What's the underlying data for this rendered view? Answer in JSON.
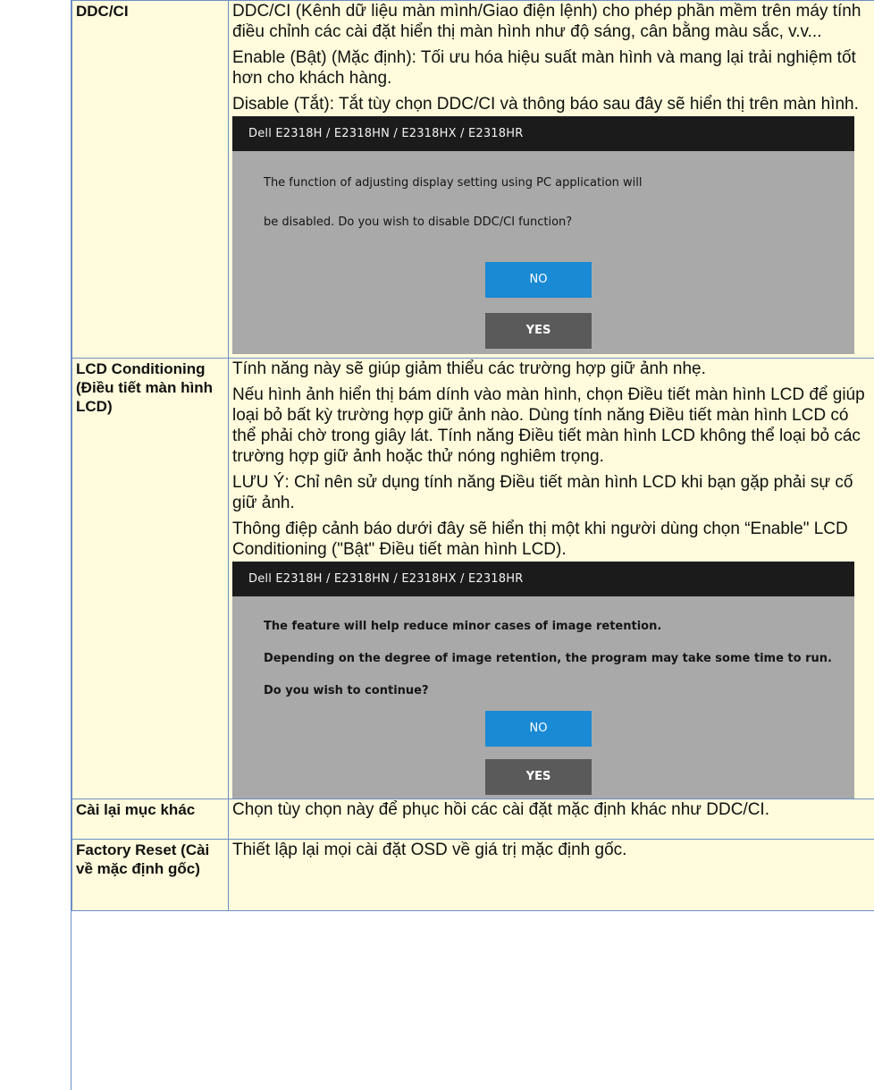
{
  "rows": [
    {
      "label": "DDC/CI",
      "paragraphs": [
        "DDC/CI (Kênh dữ liệu màn mình/Giao điện lệnh) cho phép phần mềm trên máy tính điều chỉnh các cài đặt hiển thị màn hình như độ sáng, cân bằng màu sắc, v.v...",
        "Enable (Bật) (Mặc định): Tối ưu hóa hiệu suất màn hình và mang lại trải nghiệm tốt hơn cho khách hàng.",
        "Disable (Tắt): Tắt tùy chọn DDC/CI và thông báo sau đây sẽ hiển thị trên màn hình."
      ],
      "dialog": {
        "title": "Dell  E2318H / E2318HN / E2318HX / E2318HR",
        "lines": [
          "The function of adjusting display setting using PC application will",
          "be disabled. Do you wish to disable DDC/CI function?"
        ],
        "no_label": "NO",
        "yes_label": "YES"
      }
    },
    {
      "label": "LCD Conditioning (Điều tiết màn hình LCD)",
      "paragraphs": [
        "Tính năng này sẽ giúp giảm thiểu các trường hợp giữ ảnh nhẹ.",
        "Nếu hình ảnh hiển thị bám dính vào màn hình, chọn Điều tiết màn hình LCD để giúp loại bỏ bất kỳ trường hợp giữ ảnh nào. Dùng tính năng Điều tiết màn hình LCD có thể phải chờ trong giây lát. Tính năng Điều tiết màn hình LCD không thể loại bỏ các trường hợp giữ ảnh hoặc thử nóng nghiêm trọng.",
        "LƯU Ý: Chỉ nên sử dụng tính năng Điều tiết màn hình LCD khi bạn gặp phải sự cố giữ ảnh.",
        "Thông điệp cảnh báo dưới đây sẽ hiển thị một khi người dùng chọn “Enable\" LCD Conditioning (\"Bật\" Điều tiết màn hình LCD)."
      ],
      "dialog": {
        "title": "Dell  E2318H / E2318HN / E2318HX / E2318HR",
        "lines": [
          "The feature will help reduce minor cases of image retention.",
          "Depending on the degree of image retention, the program may take some time to run.",
          "Do you wish to continue?"
        ],
        "no_label": "NO",
        "yes_label": "YES"
      }
    },
    {
      "label": "Cài lại mục khác",
      "paragraphs": [
        "Chọn tùy chọn này để phục hồi các cài đặt mặc định khác như DDC/CI."
      ]
    },
    {
      "label": "Factory Reset (Cài về mặc định gốc)",
      "paragraphs": [
        "Thiết lập lại mọi cài đặt OSD về giá trị mặc định gốc."
      ]
    }
  ]
}
